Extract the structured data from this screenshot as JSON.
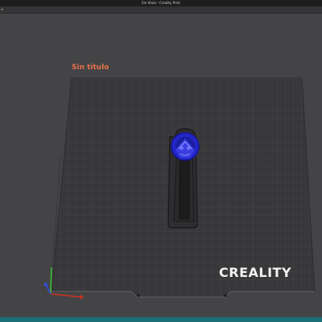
{
  "window": {
    "title": "Sin título - Creality Print"
  },
  "plate": {
    "name": "Sin título",
    "brand": "CREALITY"
  },
  "colors": {
    "accent_orange": "#e8704a",
    "model_blue": "#2b2bd6",
    "bed_dark": "#38383a",
    "background": "#444446",
    "status_teal": "#1d6f76",
    "axis_x": "#d0301e",
    "axis_y": "#3fbf3a",
    "axis_z": "#3050e0"
  },
  "icons": {
    "menu_icon": "hamburger-icon"
  }
}
